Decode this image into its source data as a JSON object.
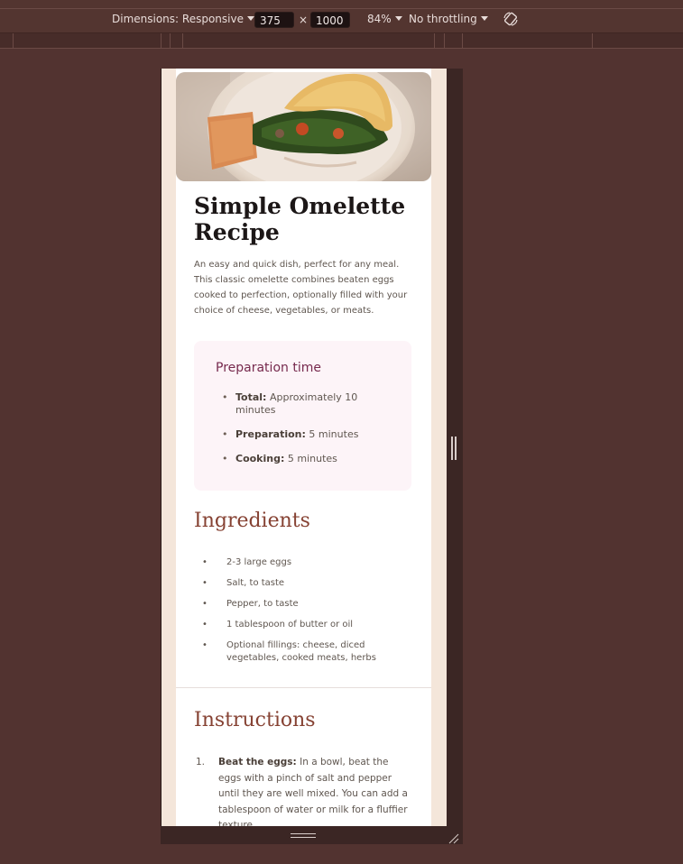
{
  "devtools": {
    "dimensions_label": "Dimensions: Responsive",
    "width": "375",
    "times": "×",
    "height": "1000",
    "zoom": "84%",
    "throttling": "No throttling",
    "rotate_icon": "rotate-icon"
  },
  "recipe": {
    "title": "Simple Omelette Recipe",
    "intro": "An easy and quick dish, perfect for any meal. This classic omelette combines beaten eggs cooked to perfection, optionally filled with your choice of cheese, vegetables, or meats.",
    "prep": {
      "heading": "Preparation time",
      "items": [
        {
          "label": "Total:",
          "text": " Approximately 10 minutes"
        },
        {
          "label": "Preparation:",
          "text": " 5 minutes"
        },
        {
          "label": "Cooking:",
          "text": " 5 minutes"
        }
      ]
    },
    "ingredients": {
      "heading": "Ingredients",
      "items": [
        "2-3 large eggs",
        "Salt, to taste",
        "Pepper, to taste",
        "1 tablespoon of butter or oil",
        "Optional fillings: cheese, diced vegetables, cooked meats, herbs"
      ]
    },
    "instructions": {
      "heading": "Instructions",
      "items": [
        {
          "num": "1.",
          "label": "Beat the eggs:",
          "text": " In a bowl, beat the eggs with a pinch of salt and pepper until they are well mixed. You can add a tablespoon of water or milk for a fluffier texture."
        }
      ]
    }
  },
  "colors": {
    "page_bg": "#523330",
    "viewport_bg": "#f4e6da",
    "heading_brown": "#864233",
    "prep_heading": "#772a4e",
    "prep_bg": "#fdf4f8"
  }
}
